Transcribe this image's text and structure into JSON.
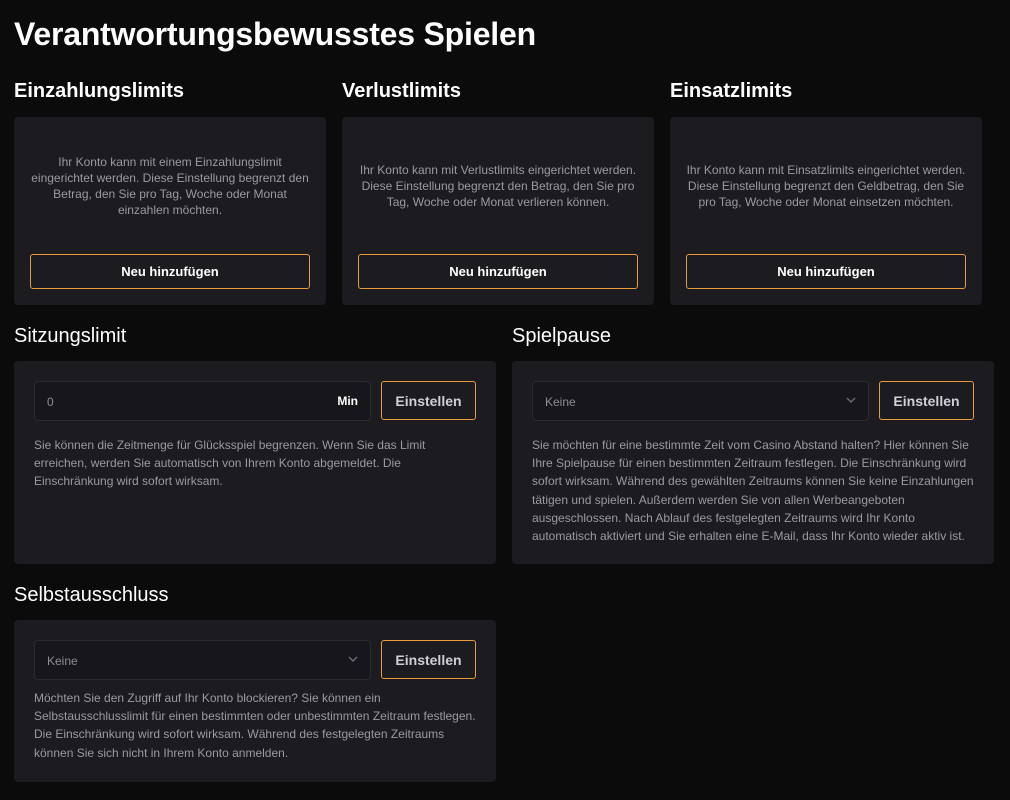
{
  "page": {
    "title": "Verantwortungsbewusstes Spielen"
  },
  "deposit": {
    "title": "Einzahlungslimits",
    "text": "Ihr Konto kann mit einem Einzahlungslimit eingerichtet werden. Diese Einstellung begrenzt den Betrag, den Sie pro Tag, Woche oder Monat einzahlen möchten.",
    "button": "Neu hinzufügen"
  },
  "loss": {
    "title": "Verlustlimits",
    "text": "Ihr Konto kann mit Verlustlimits eingerichtet werden. Diese Einstellung begrenzt den Betrag, den Sie pro Tag, Woche oder Monat verlieren können.",
    "button": "Neu hinzufügen"
  },
  "wager": {
    "title": "Einsatzlimits",
    "text": "Ihr Konto kann mit Einsatzlimits eingerichtet werden. Diese Einstellung begrenzt den Geldbetrag, den Sie pro Tag, Woche oder Monat einsetzen möchten.",
    "button": "Neu hinzufügen"
  },
  "session": {
    "title": "Sitzungslimit",
    "value": "0",
    "unit": "Min",
    "button": "Einstellen",
    "text": "Sie können die Zeitmenge für Glücksspiel begrenzen. Wenn Sie das Limit erreichen, werden Sie automatisch von Ihrem Konto abgemeldet. Die Einschränkung wird sofort wirksam."
  },
  "pause": {
    "title": "Spielpause",
    "selected": "Keine",
    "button": "Einstellen",
    "text": "Sie möchten für eine bestimmte Zeit vom Casino Abstand halten? Hier können Sie Ihre Spielpause für einen bestimmten Zeitraum festlegen. Die Einschränkung wird sofort wirksam. Während des gewählten Zeitraums können Sie keine Einzahlungen tätigen und spielen. Außerdem werden Sie von allen Werbeangeboten ausgeschlossen. Nach Ablauf des festgelegten Zeitraums wird Ihr Konto automatisch aktiviert und Sie erhalten eine E-Mail, dass Ihr Konto wieder aktiv ist."
  },
  "exclusion": {
    "title": "Selbstausschluss",
    "selected": "Keine",
    "button": "Einstellen",
    "text": "Möchten Sie den Zugriff auf Ihr Konto blockieren? Sie können ein Selbstausschlusslimit für einen bestimmten oder unbestimmten Zeitraum festlegen. Die Einschränkung wird sofort wirksam. Während des festgelegten Zeitraums können Sie sich nicht in Ihrem Konto anmelden."
  },
  "colors": {
    "accent": "#e89a3c",
    "card": "#1b1b20",
    "background": "#0b0b0c"
  },
  "icons": {
    "dropdown": "chevron-down-icon"
  }
}
